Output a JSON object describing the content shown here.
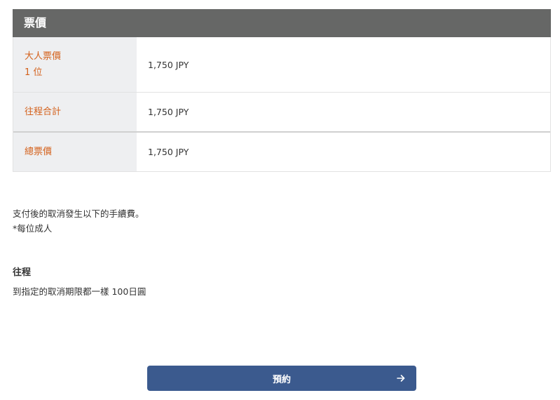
{
  "price_panel": {
    "title": "票價",
    "rows": [
      {
        "label": "大人票價",
        "sublabel": "1 位",
        "value": "1,750 JPY"
      },
      {
        "label": "往程合計",
        "value": "1,750 JPY"
      },
      {
        "label": "總票價",
        "value": "1,750 JPY"
      }
    ]
  },
  "cancellation": {
    "note_line1": "支付後的取消發生以下的手續費。",
    "note_line2": "*每位成人",
    "leg_title": "往程",
    "leg_fee_text": "到指定的取消期限都一樣 100日圓"
  },
  "booking": {
    "button_label": "預約",
    "button_icon": "arrow-right-icon"
  },
  "colors": {
    "header_bg": "#666766",
    "label_text": "#d4611c",
    "label_bg": "#eeeff1",
    "button_bg": "#3b5a8e"
  }
}
